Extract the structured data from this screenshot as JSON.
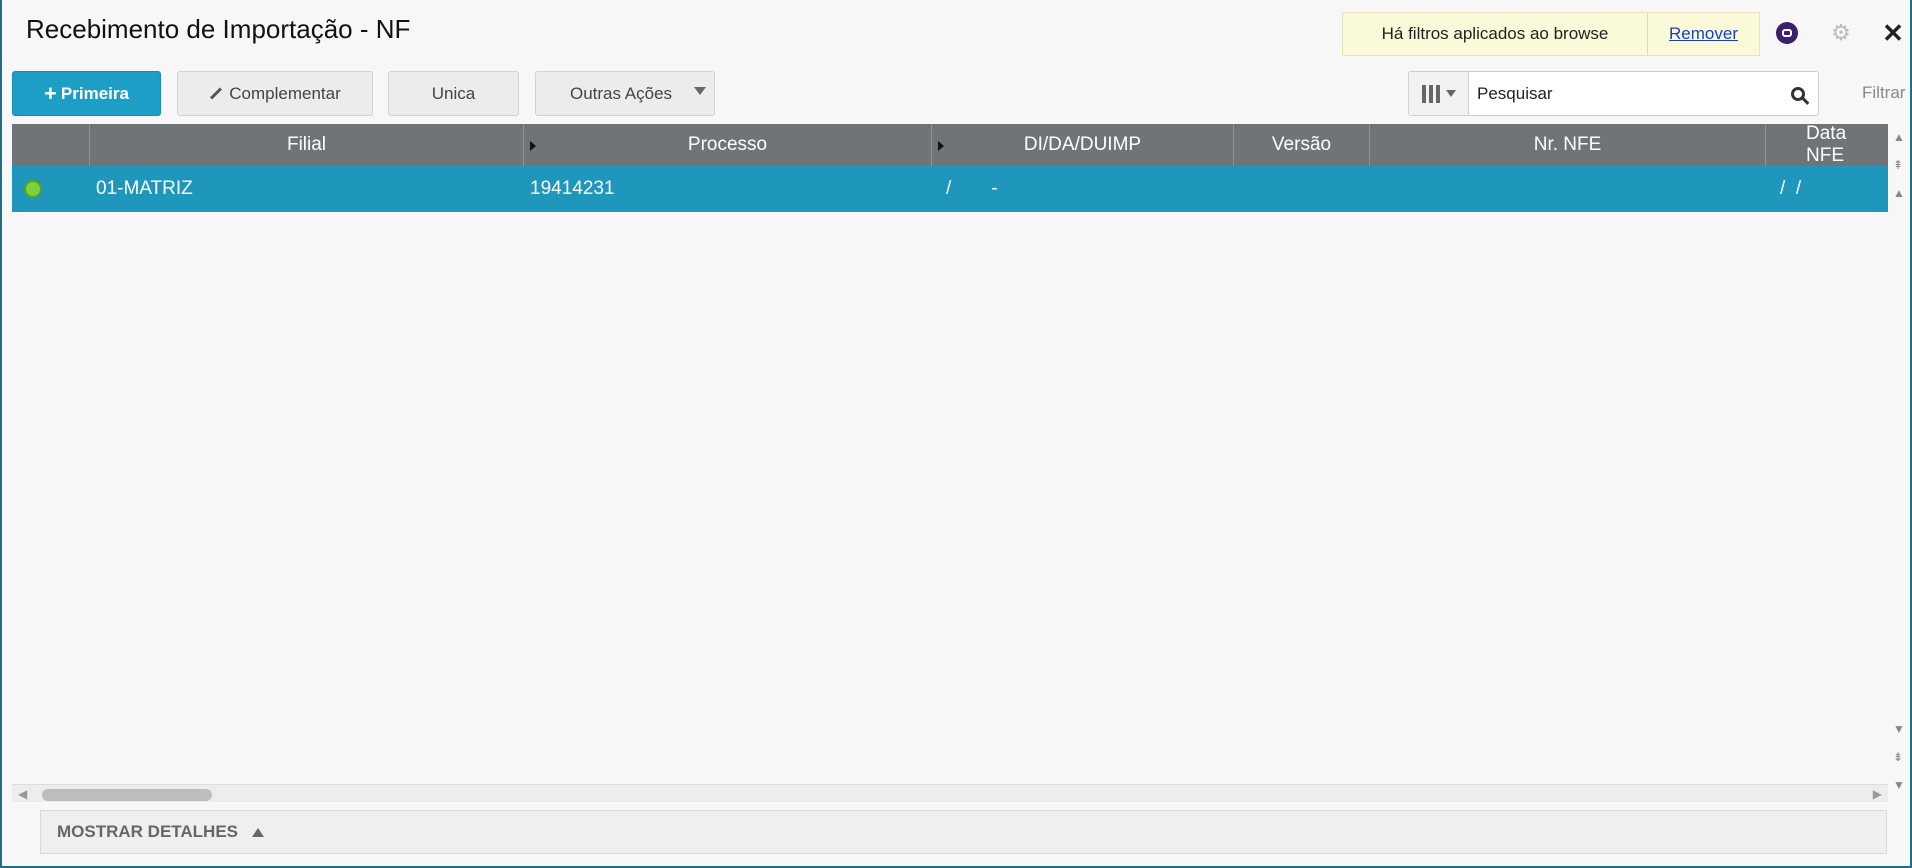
{
  "window": {
    "title": "Recebimento de Importação - NF"
  },
  "filter_notice": {
    "message": "Há filtros aplicados ao browse",
    "remove_label": "Remover"
  },
  "toolbar": {
    "primeira_label": "Primeira",
    "complementar_label": "Complementar",
    "unica_label": "Unica",
    "outras_label": "Outras Ações"
  },
  "search": {
    "placeholder": "Pesquisar",
    "filter_label": "Filtrar"
  },
  "grid": {
    "columns": [
      "Filial",
      "Processo",
      "DI/DA/DUIMP",
      "Versão",
      "Nr. NFE",
      "Data NFE"
    ],
    "rows": [
      {
        "status_color": "#7bd23a",
        "filial": "01-MATRIZ",
        "processo": "19414231",
        "di_sep1": "/",
        "di_sep2": "-",
        "versao": "",
        "nr_nfe": "",
        "data_nfe": "/  /"
      }
    ]
  },
  "details": {
    "label": "MOSTRAR DETALHES"
  },
  "icons": [
    "assistant-icon",
    "gear-icon",
    "close-icon",
    "search-icon",
    "column-picker-icon"
  ]
}
